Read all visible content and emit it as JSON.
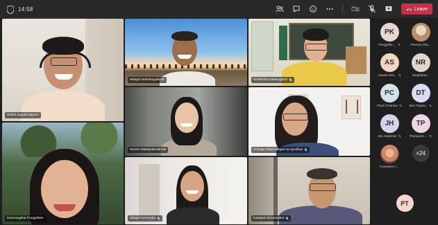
{
  "topbar": {
    "timer": "14:58",
    "leave_label": "Leave"
  },
  "tiles": [
    {
      "name": "Wittch Sugathotigram"
    },
    {
      "name": "Witapol Mahiseypahorn"
    },
    {
      "name": "Wuthichai Sawangphol"
    },
    {
      "name": "Sermit Wattapakunbhedi"
    },
    {
      "name": "Srisupa Palakvangsa na ayudhya"
    },
    {
      "name": "Dumrongthai Pongpiktee"
    },
    {
      "name": "Jidapa Kumanjda"
    },
    {
      "name": "Kanapot Simansakul"
    }
  ],
  "participants": [
    {
      "initials": "PK",
      "label": "Pongpalin ...",
      "color": "#e8d4d2"
    },
    {
      "initials": "",
      "label": "Peemai Cha...",
      "color": "#c7a98a"
    },
    {
      "initials": "AS",
      "label": "Ananta Sris...",
      "color": "#f3d5c0"
    },
    {
      "initials": "NR",
      "label": "Noppharat...",
      "color": "#e0d6cc"
    },
    {
      "initials": "PC",
      "label": "Prach Chanton",
      "color": "#cfe3e8"
    },
    {
      "initials": "DT",
      "label": "Den Tupaw...",
      "color": "#d8dcf2"
    },
    {
      "initials": "JH",
      "label": "Jira Hulaiman",
      "color": "#d6d2ea"
    },
    {
      "initials": "TP",
      "label": "Thanaporn ...",
      "color": "#f0d4e2"
    },
    {
      "initials": "",
      "label": "Kunwanee I...",
      "color": "#c98a6a"
    }
  ],
  "more_count": "+24",
  "self_view": {
    "initials": "PT",
    "color": "#f6d6cc"
  }
}
